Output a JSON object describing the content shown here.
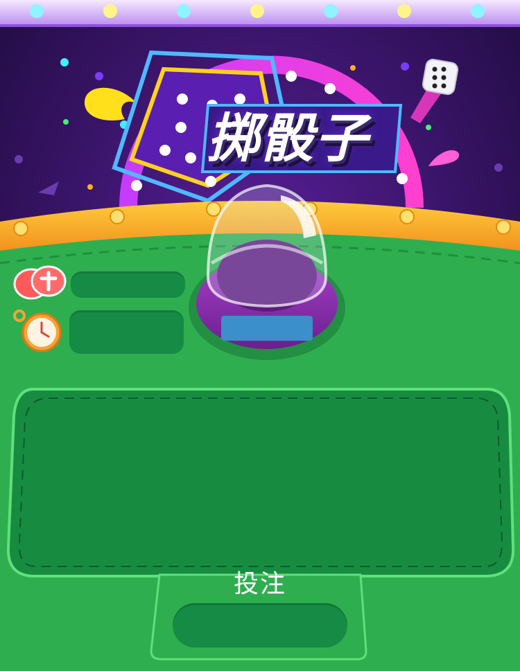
{
  "game": {
    "title": "掷骰子"
  },
  "hud": {
    "chips_value": "",
    "timer_value": "",
    "chips_icon": "chips-icon",
    "timer_icon": "stopwatch-icon"
  },
  "cup": {
    "result_label": ""
  },
  "bet": {
    "label": "投注",
    "button_value": ""
  },
  "colors": {
    "table_green": "#2fae4f",
    "felt_dark_green": "#168b45",
    "rail_orange": "#f5a623",
    "neon_purple": "#b03cff",
    "background_purple": "#2a1250"
  }
}
